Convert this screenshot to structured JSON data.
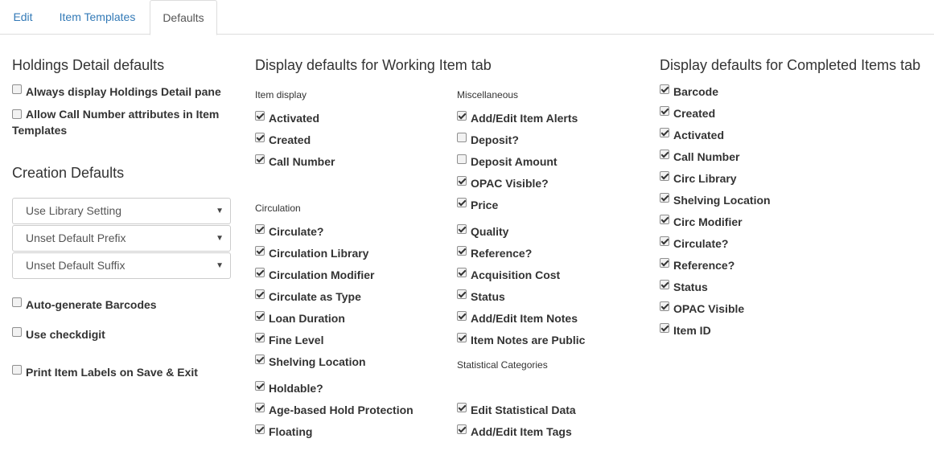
{
  "tabs": [
    {
      "label": "Edit"
    },
    {
      "label": "Item Templates"
    },
    {
      "label": "Defaults"
    }
  ],
  "holdings": {
    "title": "Holdings Detail defaults",
    "items": [
      {
        "label": "Always display Holdings Detail pane",
        "checked": false
      },
      {
        "label": "Allow Call Number attributes in Item Templates",
        "checked": false
      }
    ]
  },
  "creation": {
    "title": "Creation Defaults",
    "selects": [
      {
        "value": "Use Library Setting"
      },
      {
        "value": "Unset Default Prefix"
      },
      {
        "value": "Unset Default Suffix"
      }
    ],
    "items": [
      {
        "label": "Auto-generate Barcodes",
        "checked": false
      },
      {
        "label": "Use checkdigit",
        "checked": false
      },
      {
        "label": "Print Item Labels on Save & Exit",
        "checked": false
      }
    ]
  },
  "working": {
    "title": "Display defaults for Working Item tab",
    "item_display": {
      "label": "Item display",
      "items": [
        {
          "label": "Activated",
          "checked": true
        },
        {
          "label": "Created",
          "checked": true
        },
        {
          "label": "Call Number",
          "checked": true
        }
      ]
    },
    "circulation": {
      "label": "Circulation",
      "items": [
        {
          "label": "Circulate?",
          "checked": true
        },
        {
          "label": "Circulation Library",
          "checked": true
        },
        {
          "label": "Circulation Modifier",
          "checked": true
        },
        {
          "label": "Circulate as Type",
          "checked": true
        },
        {
          "label": "Loan Duration",
          "checked": true
        },
        {
          "label": "Fine Level",
          "checked": true
        },
        {
          "label": "Shelving Location",
          "checked": true
        },
        {
          "label": "Holdable?",
          "checked": true
        },
        {
          "label": "Age-based Hold Protection",
          "checked": true
        },
        {
          "label": "Floating",
          "checked": true
        }
      ]
    },
    "misc": {
      "label": "Miscellaneous",
      "items": [
        {
          "label": "Add/Edit Item Alerts",
          "checked": true
        },
        {
          "label": "Deposit?",
          "checked": false
        },
        {
          "label": "Deposit Amount",
          "checked": false
        },
        {
          "label": "OPAC Visible?",
          "checked": true
        },
        {
          "label": "Price",
          "checked": true
        },
        {
          "label": "Quality",
          "checked": true
        },
        {
          "label": "Reference?",
          "checked": true
        },
        {
          "label": "Acquisition Cost",
          "checked": true
        },
        {
          "label": "Status",
          "checked": true
        },
        {
          "label": "Add/Edit Item Notes",
          "checked": true
        },
        {
          "label": "Item Notes are Public",
          "checked": true
        }
      ]
    },
    "stat": {
      "label": "Statistical Categories",
      "items": [
        {
          "label": "Edit Statistical Data",
          "checked": true
        },
        {
          "label": "Add/Edit Item Tags",
          "checked": true
        }
      ]
    }
  },
  "completed": {
    "title": "Display defaults for Completed Items tab",
    "items": [
      {
        "label": "Barcode",
        "checked": true
      },
      {
        "label": "Created",
        "checked": true
      },
      {
        "label": "Activated",
        "checked": true
      },
      {
        "label": "Call Number",
        "checked": true
      },
      {
        "label": "Circ Library",
        "checked": true
      },
      {
        "label": "Shelving Location",
        "checked": true
      },
      {
        "label": "Circ Modifier",
        "checked": true
      },
      {
        "label": "Circulate?",
        "checked": true
      },
      {
        "label": "Reference?",
        "checked": true
      },
      {
        "label": "Status",
        "checked": true
      },
      {
        "label": "OPAC Visible",
        "checked": true
      },
      {
        "label": "Item ID",
        "checked": true
      }
    ]
  }
}
